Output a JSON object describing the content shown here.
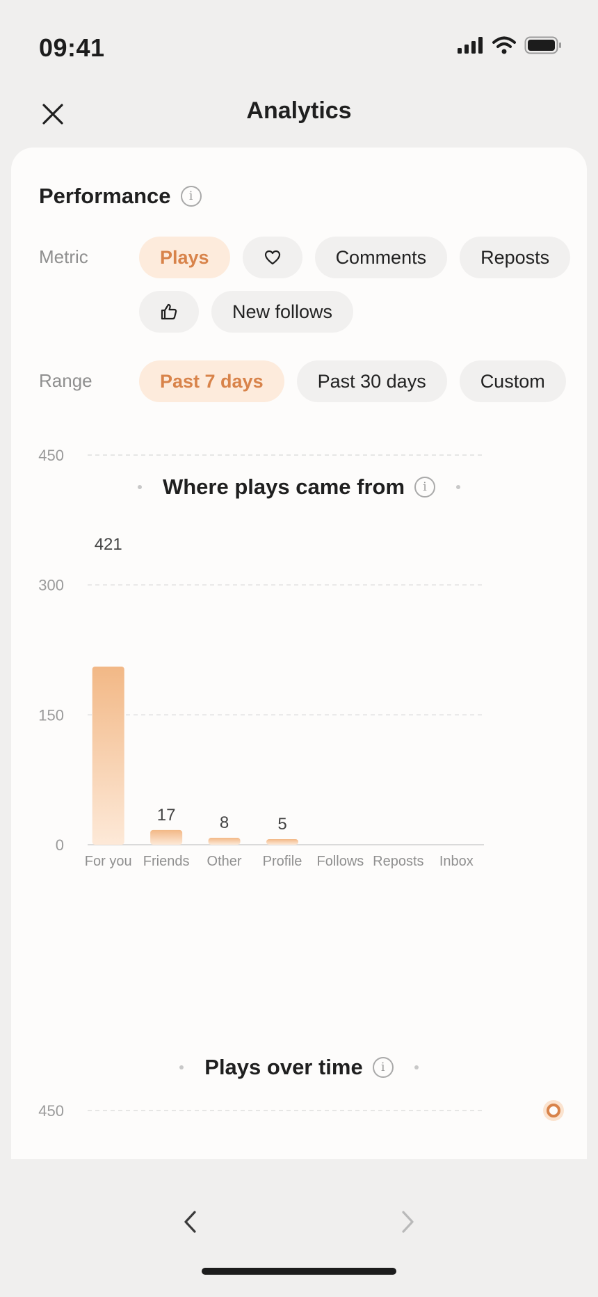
{
  "status_bar": {
    "time": "09:41"
  },
  "header": {
    "title": "Analytics"
  },
  "performance": {
    "title": "Performance",
    "metric_label": "Metric",
    "metrics": [
      {
        "label": "Plays",
        "active": true
      },
      {
        "label": "",
        "icon": "heart-icon"
      },
      {
        "label": "Comments"
      },
      {
        "label": "Reposts"
      },
      {
        "label": "",
        "icon": "thumbs-up-icon"
      },
      {
        "label": "New follows"
      }
    ],
    "range_label": "Range",
    "ranges": [
      {
        "label": "Past 7 days",
        "active": true
      },
      {
        "label": "Past 30 days"
      },
      {
        "label": "Custom"
      }
    ]
  },
  "colors": {
    "accent": "#d8834a",
    "accent_soft": "#fdebdc",
    "bar_top": "#f2b886",
    "bar_bottom": "#fde9d8"
  },
  "chart_data": [
    {
      "type": "bar",
      "title": "Where plays came from",
      "categories": [
        "For you",
        "Friends",
        "Other",
        "Profile",
        "Follows",
        "Reposts",
        "Inbox"
      ],
      "values": [
        421,
        17,
        8,
        5,
        0,
        0,
        0
      ],
      "data_labels": [
        "421",
        "17",
        "8",
        "5",
        "",
        "",
        ""
      ],
      "yticks": [
        0,
        150,
        300,
        450
      ],
      "ylim": [
        0,
        450
      ],
      "grid": true
    },
    {
      "type": "line",
      "title": "Plays over time",
      "yticks": [
        450
      ],
      "visible_point_value": 450,
      "grid": true
    }
  ]
}
